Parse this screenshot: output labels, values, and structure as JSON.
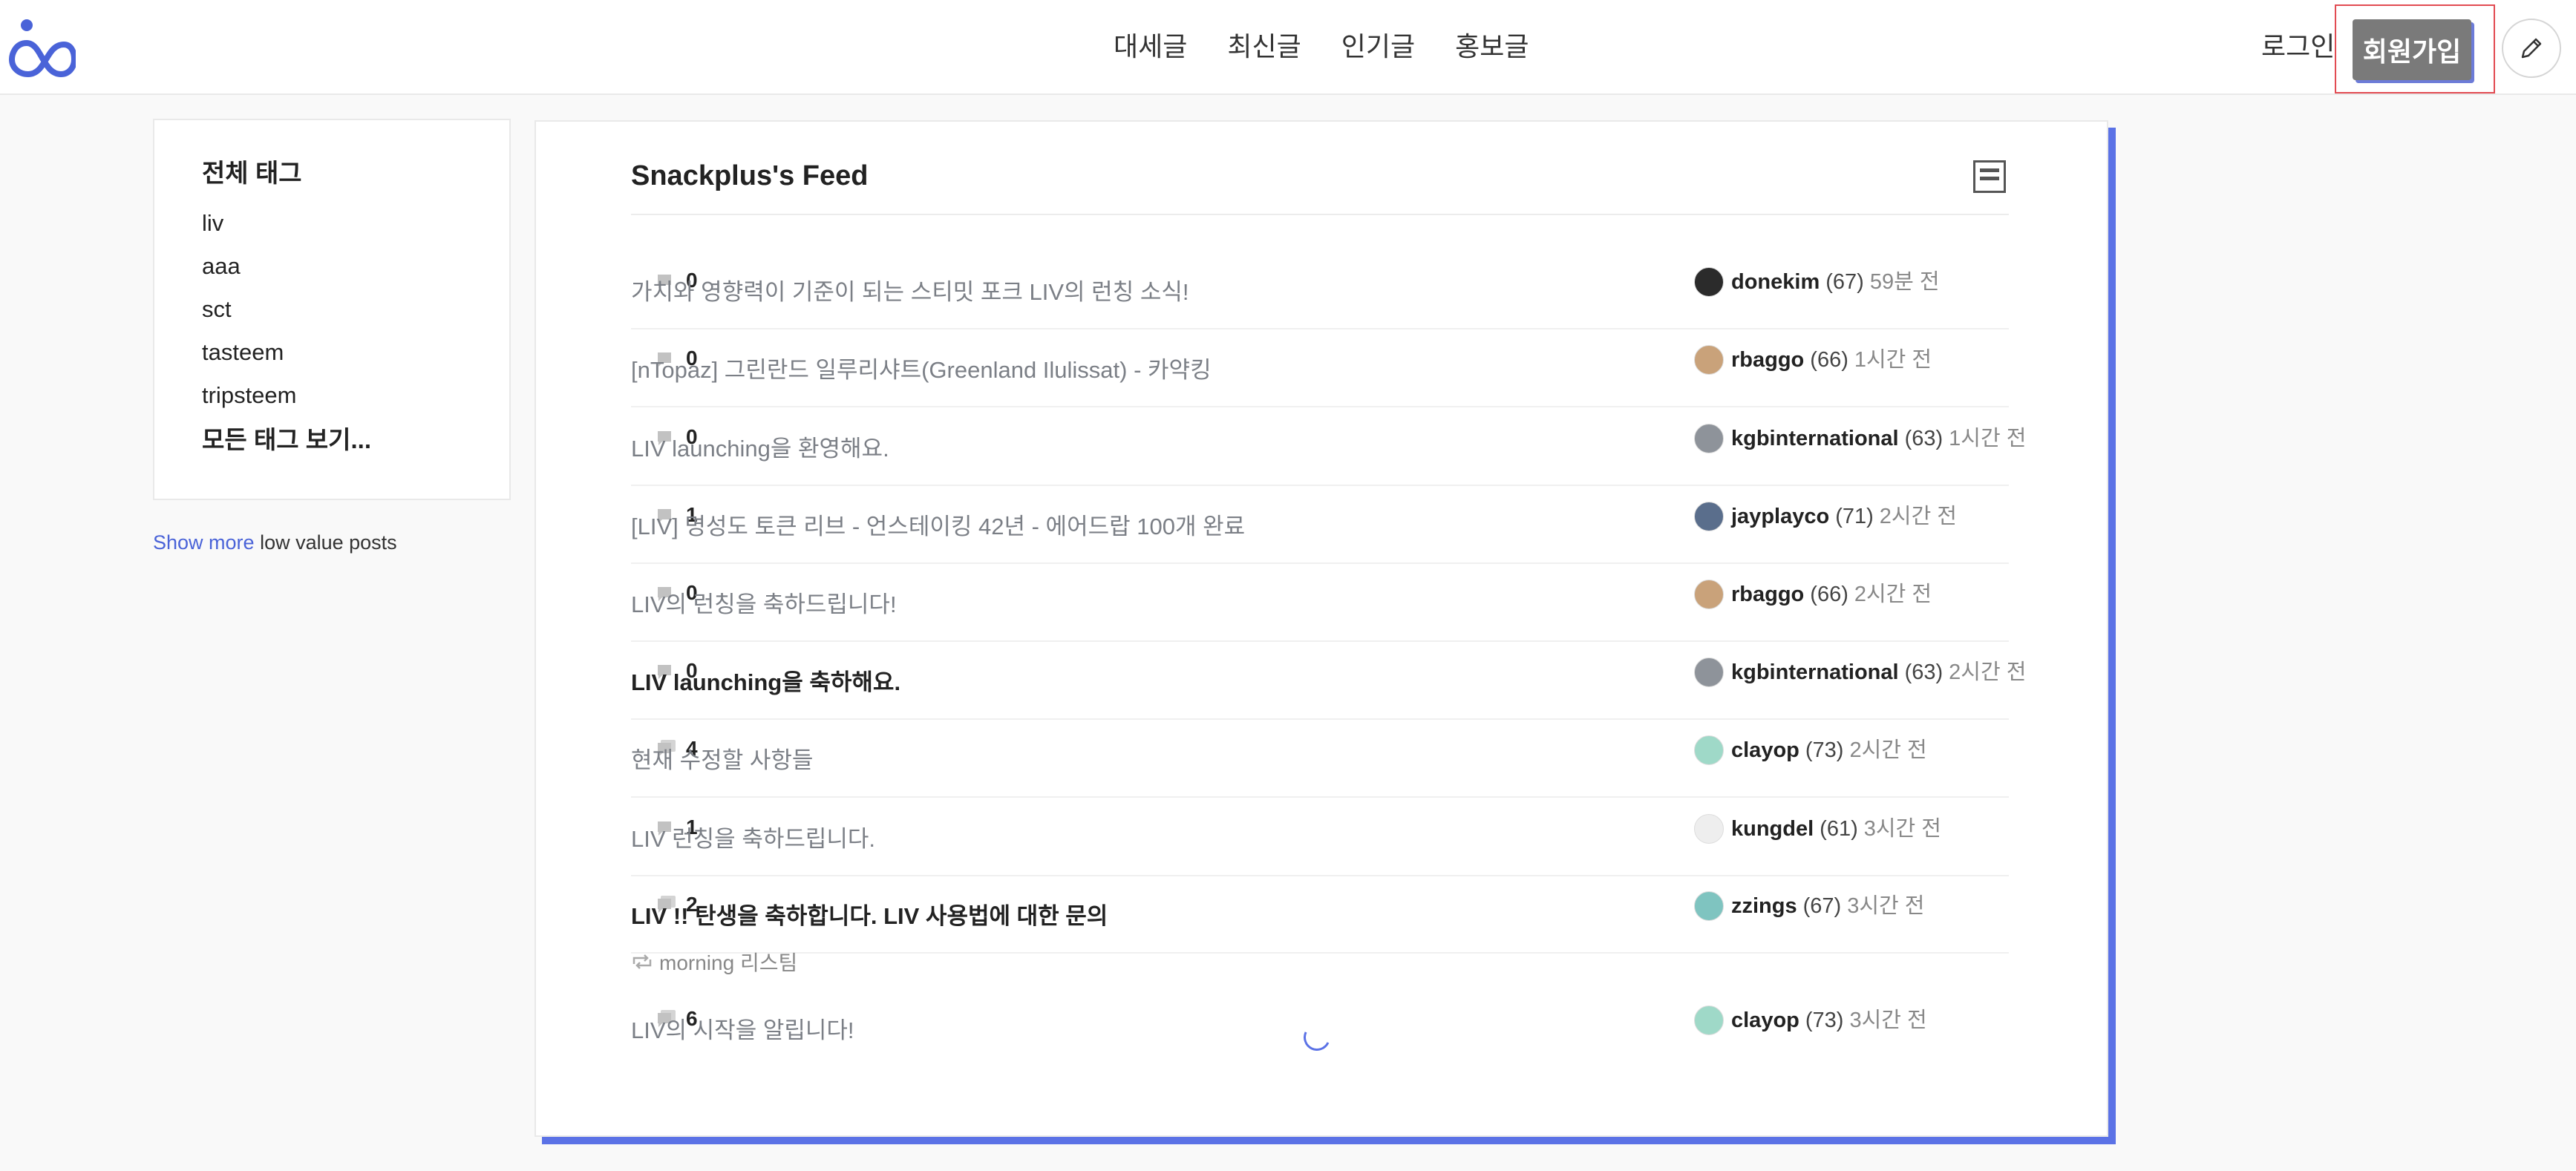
{
  "header": {
    "nav": [
      "대세글",
      "최신글",
      "인기글",
      "홍보글"
    ],
    "login": "로그인",
    "signup": "회원가입"
  },
  "sidebar": {
    "title": "전체 태그",
    "tags": [
      "liv",
      "aaa",
      "sct",
      "tasteem",
      "tripsteem"
    ],
    "all_tags": "모든 태그 보기...",
    "show_more_link": "Show more",
    "show_more_rest": " low value posts"
  },
  "feed": {
    "title": "Snackplus's Feed",
    "reblog_label": "morning 리스팀",
    "posts": [
      {
        "title": "가치와 영향력이 기준이 되는 스티밋 포크 LIV의 런칭 소식!",
        "comments": "0",
        "author": "donekim",
        "rep": "(67)",
        "time": "59분 전",
        "bold": false
      },
      {
        "title": "[nTopaz] 그린란드 일루리샤트(Greenland Ilulissat) - 카약킹",
        "comments": "0",
        "author": "rbaggo",
        "rep": "(66)",
        "time": "1시간 전",
        "bold": false
      },
      {
        "title": "LIV launching을 환영해요.",
        "comments": "0",
        "author": "kgbinternational",
        "rep": "(63)",
        "time": "1시간 전",
        "bold": false
      },
      {
        "title": "[LIV] 명성도 토큰 리브 - 언스테이킹 42년 - 에어드랍 100개 완료",
        "comments": "1",
        "author": "jayplayco",
        "rep": "(71)",
        "time": "2시간 전",
        "bold": false
      },
      {
        "title": "LIV의 런칭을 축하드립니다!",
        "comments": "0",
        "author": "rbaggo",
        "rep": "(66)",
        "time": "2시간 전",
        "bold": false
      },
      {
        "title": "LIV launching을 축하해요.",
        "comments": "0",
        "author": "kgbinternational",
        "rep": "(63)",
        "time": "2시간 전",
        "bold": true
      },
      {
        "title": "현재 수정할 사항들",
        "comments": "4",
        "author": "clayop",
        "rep": "(73)",
        "time": "2시간 전",
        "bold": false
      },
      {
        "title": "LIV 런칭을 축하드립니다.",
        "comments": "1",
        "author": "kungdel",
        "rep": "(61)",
        "time": "3시간 전",
        "bold": false
      },
      {
        "title": "LIV !! 탄생을 축하합니다. LIV 사용법에 대한 문의",
        "comments": "2",
        "author": "zzings",
        "rep": "(67)",
        "time": "3시간 전",
        "bold": true
      },
      {
        "title": "LIV의 시작을 알립니다!",
        "comments": "6",
        "author": "clayop",
        "rep": "(73)",
        "time": "3시간 전",
        "bold": false
      }
    ]
  },
  "colors": {
    "accent": "#5b72e6",
    "signup_bg": "#7a7a7a",
    "highlight_border": "#e24b52"
  },
  "avatar_colors": [
    "#2b2b2b",
    "#c9a27a",
    "#8e939a",
    "#5a6e8c",
    "#c9a27a",
    "#8e939a",
    "#9fd9c8",
    "#eeeeee",
    "#7fc4c0",
    "#9fd9c8"
  ]
}
